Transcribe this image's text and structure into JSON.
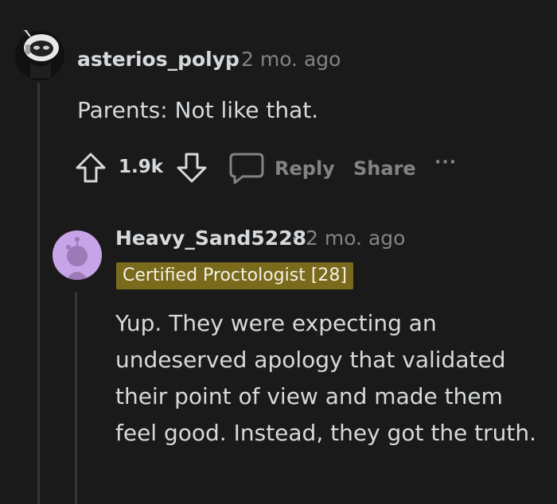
{
  "comments": [
    {
      "username": "asterios_polyp",
      "separator": "·",
      "time": "2 mo. ago",
      "body": "Parents: Not like that.",
      "votes": "1.9k",
      "reply_label": "Reply",
      "share_label": "Share",
      "more_label": "···"
    },
    {
      "username": "Heavy_Sand5228",
      "separator": "·",
      "time": "2 mo. ago",
      "flair": "Certified Proctologist [28]",
      "body": "Yup. They were expecting an undeserved apology that validated their point of view and made them feel good. Instead, they got the truth."
    }
  ],
  "colors": {
    "background": "#1a1a1b",
    "text": "#d7dadc",
    "muted": "#818384",
    "flair_bg": "#7a6a1c",
    "avatar2_bg": "#c7a3e8"
  }
}
